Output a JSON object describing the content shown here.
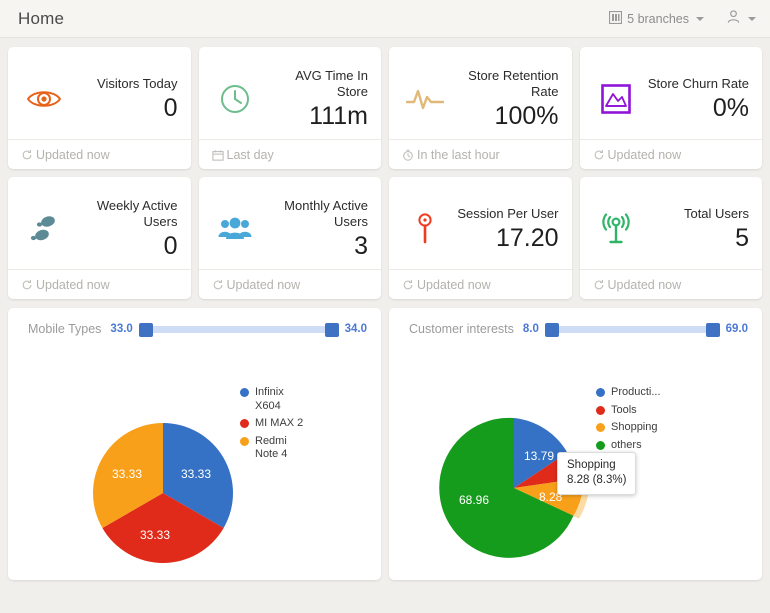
{
  "header": {
    "title": "Home",
    "branches_label": "5 branches",
    "branch_icon": "store-icon",
    "user_icon": "user-icon"
  },
  "kpis": [
    {
      "label": "Visitors\nToday",
      "value": "0",
      "footer": "Updated now",
      "footer_icon": "refresh-icon",
      "icon": "eye-icon",
      "color": "#e8631a"
    },
    {
      "label": "AVG Time In\nStore",
      "value": "111m",
      "footer": "Last day",
      "footer_icon": "calendar-icon",
      "icon": "clock-icon",
      "color": "#6dbd8c"
    },
    {
      "label": "Store Retention\nRate",
      "value": "100%",
      "footer": "In the last hour",
      "footer_icon": "stopwatch-icon",
      "icon": "pulse-icon",
      "color": "#e0b97a"
    },
    {
      "label": "Store Churn\nRate",
      "value": "0%",
      "footer": "Updated now",
      "footer_icon": "refresh-icon",
      "icon": "area-chart-icon",
      "color": "#9013d8"
    },
    {
      "label": "Weekly Active\nUsers",
      "value": "0",
      "footer": "Updated now",
      "footer_icon": "refresh-icon",
      "icon": "footprints-icon",
      "color": "#5c8a95"
    },
    {
      "label": "Monthly Active\nUsers",
      "value": "3",
      "footer": "Updated now",
      "footer_icon": "refresh-icon",
      "icon": "users-icon",
      "color": "#49a8d8"
    },
    {
      "label": "Session Per\nUser",
      "value": "17.20",
      "footer": "Updated now",
      "footer_icon": "refresh-icon",
      "icon": "map-pin-icon",
      "color": "#f03b20"
    },
    {
      "label": "Total Users",
      "value": "5",
      "footer": "Updated now",
      "footer_icon": "refresh-icon",
      "icon": "broadcast-icon",
      "color": "#2fb567"
    }
  ],
  "panels": [
    {
      "title": "Mobile Types",
      "slider": {
        "min_label": "33.0",
        "max_label": "34.0",
        "min": 33.0,
        "max": 34.0
      }
    },
    {
      "title": "Customer interests",
      "slider": {
        "min_label": "8.0",
        "max_label": "69.0",
        "min": 8.0,
        "max": 69.0
      }
    }
  ],
  "tooltip": {
    "title": "Shopping",
    "value": "8.28 (8.3%)"
  },
  "chart_data": [
    {
      "type": "pie",
      "title": "Mobile Types",
      "legend_position": "right",
      "categories": [
        "Infinix\nX604",
        "MI MAX 2",
        "Redmi\nNote 4"
      ],
      "values": [
        33.33,
        33.33,
        33.33
      ],
      "labels": [
        "33.33",
        "33.33",
        "33.33"
      ],
      "colors": [
        "#3571c4",
        "#e02b1b",
        "#f9a01b"
      ]
    },
    {
      "type": "pie",
      "title": "Customer interests",
      "legend_position": "right",
      "categories": [
        "Producti...",
        "Tools",
        "Shopping",
        "others"
      ],
      "values": [
        13.79,
        8.97,
        8.28,
        68.96
      ],
      "labels": [
        "13.79",
        "",
        "8.28",
        "68.96"
      ],
      "colors": [
        "#3571c4",
        "#e02b1b",
        "#f9a01b",
        "#169c1d"
      ],
      "exploded": "Shopping"
    }
  ]
}
